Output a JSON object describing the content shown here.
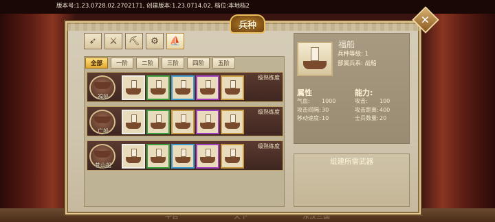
{
  "version_text": "版本号:1.23.0728.02.2702171,  创建版本:1.23.0714.02, 档位:本地档2",
  "title": "兵种",
  "close_label": "✕",
  "category_icons": [
    {
      "name": "bow-icon",
      "glyph": "➶"
    },
    {
      "name": "sword-icon",
      "glyph": "⚔"
    },
    {
      "name": "cannon-icon",
      "glyph": "⛏"
    },
    {
      "name": "chariot-icon",
      "glyph": "⚙"
    },
    {
      "name": "ship-icon",
      "glyph": "⛵",
      "active": true
    }
  ],
  "tabs": [
    "全部",
    "一阶",
    "二阶",
    "三阶",
    "四阶",
    "五阶"
  ],
  "active_tab": 0,
  "rows": [
    {
      "name": "福船",
      "label": "级熟练度",
      "rarity_colors": [
        "#f0eee8",
        "#3aa040",
        "#3a9ad0",
        "#a040c0",
        "#c89a40"
      ]
    },
    {
      "name": "广船",
      "label": "级熟练度",
      "rarity_colors": [
        "#f0eee8",
        "#3aa040",
        "#c89a40",
        "#a040c0",
        "#c89a40"
      ]
    },
    {
      "name": "苍山船",
      "label": "级熟练度",
      "rarity_colors": [
        "#f0eee8",
        "#3aa040",
        "#3a9ad0",
        "#a040c0",
        "#c89a40"
      ]
    }
  ],
  "detail": {
    "name": "福船",
    "level": "兵种等级: 1",
    "family": "部属兵系: 战船",
    "section_attr": "属性",
    "section_power": "能力:",
    "stats_left": [
      {
        "k": "气血:",
        "v": "1000"
      },
      {
        "k": "攻击间隔:",
        "v": "30"
      },
      {
        "k": "移动速度:",
        "v": "10"
      }
    ],
    "stats_right": [
      {
        "k": "攻击:",
        "v": "100"
      },
      {
        "k": "攻击距离:",
        "v": "400"
      },
      {
        "k": "士兵数量:",
        "v": "20"
      }
    ],
    "build_label": "组建所需武器"
  },
  "bottom_ghost": [
    "平台",
    "天下",
    "东汉三国"
  ]
}
